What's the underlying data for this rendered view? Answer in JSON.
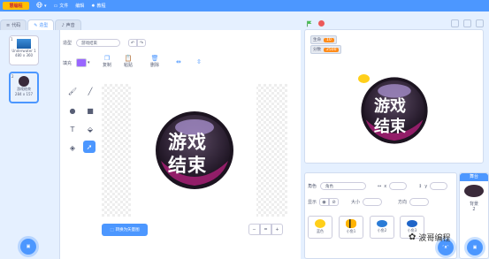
{
  "topbar": {
    "logo_text": "慧编程",
    "menu_items": [
      {
        "label": "文件"
      },
      {
        "label": "编辑"
      },
      {
        "label": "教程"
      }
    ],
    "language_badge": "▾"
  },
  "tabs": [
    {
      "label": "代码"
    },
    {
      "label": "造型"
    },
    {
      "label": "声音"
    }
  ],
  "costumes": [
    {
      "num": "1",
      "name": "Underwater 1",
      "size": "480 x 360"
    },
    {
      "num": "2",
      "name": "游戏结束",
      "size": "284 x 157"
    }
  ],
  "editor": {
    "costume_label": "造型",
    "costume_name": "游戏结束",
    "fill_label": "填充",
    "fill_color": "#9966ff",
    "actions": [
      {
        "label": "复制"
      },
      {
        "label": "粘贴"
      },
      {
        "label": "删除"
      }
    ],
    "convert_button": "转换为矢量图",
    "zoom_out": "−",
    "zoom_reset": "=",
    "zoom_in": "+"
  },
  "artwork": {
    "line1": "游戏",
    "line2": "结束"
  },
  "stage": {
    "monitors": [
      {
        "label": "生命",
        "value": "10"
      },
      {
        "label": "分数",
        "value": "2500"
      }
    ]
  },
  "sprite_info": {
    "sprite_label": "角色",
    "sprite_name": "角色",
    "show_label": "显示",
    "size_label": "大小",
    "direction_label": "方向",
    "x_label": "x",
    "y_label": "y",
    "sprites": [
      {
        "name": "蓝色"
      },
      {
        "name": "小鱼1"
      },
      {
        "name": "小鱼2"
      },
      {
        "name": "小鱼3"
      }
    ]
  },
  "stage_panel": {
    "title": "舞台",
    "backdrops_label": "背景",
    "backdrops_count": "2"
  },
  "watermark": "波哥编程",
  "colors": {
    "accent": "#4c97ff",
    "orange": "#ff8c1a",
    "green_flag": "#4cbf56",
    "stop": "#ec5959"
  }
}
